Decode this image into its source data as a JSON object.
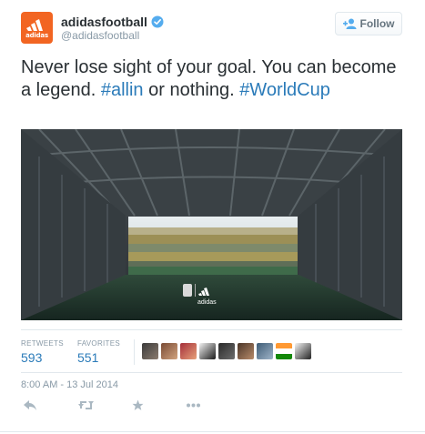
{
  "account": {
    "display_name": "adidasfootball",
    "handle": "@adidasfootball",
    "avatar_text": "adidas",
    "verified": true,
    "brand_color": "#f26522"
  },
  "follow_button": {
    "label": "Follow",
    "icon": "add-user-icon"
  },
  "tweet": {
    "text_part1": "Never lose sight of your goal. You can become a legend. ",
    "hashtag1": "#allin",
    "text_part2": " or nothing. ",
    "hashtag2": "#WorldCup",
    "link_color": "#2b7bb9"
  },
  "photo": {
    "logo_text": "adidas",
    "scene": "stadium-tunnel"
  },
  "stats": {
    "retweets_label": "RETWEETS",
    "retweets_value": "593",
    "favorites_label": "FAVORITES",
    "favorites_value": "551",
    "favoriter_avatars": 9
  },
  "timestamp": "8:00 AM - 13 Jul 2014",
  "actions": [
    {
      "name": "reply",
      "icon": "reply-icon"
    },
    {
      "name": "retweet",
      "icon": "retweet-icon"
    },
    {
      "name": "favorite",
      "icon": "star-icon"
    },
    {
      "name": "more",
      "icon": "more-icon"
    }
  ]
}
